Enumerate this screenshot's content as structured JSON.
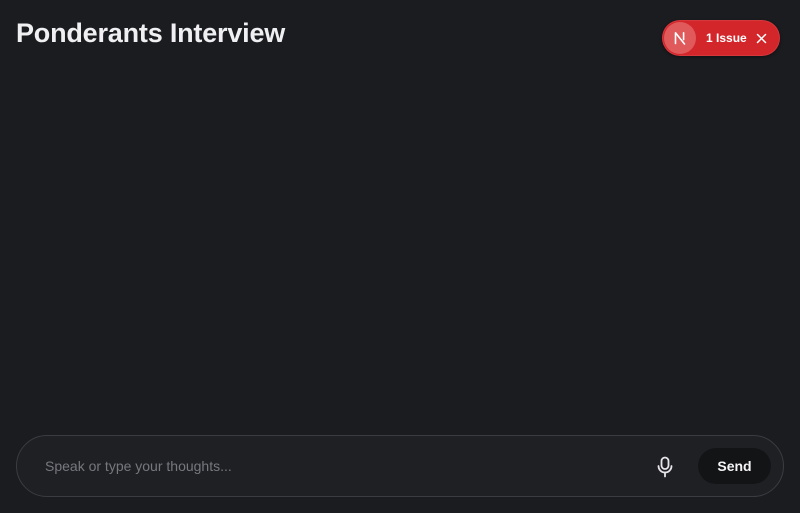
{
  "header": {
    "title": "Ponderants Interview"
  },
  "issue_badge": {
    "logo_icon": "nextjs-logo-icon",
    "label": "1 Issue",
    "close_icon": "close-icon",
    "color": "#d3262b"
  },
  "composer": {
    "input_value": "",
    "input_placeholder": "Speak or type your thoughts...",
    "mic_icon": "microphone-icon",
    "send_label": "Send"
  },
  "colors": {
    "background": "#1b1c20",
    "composer_border": "#3b3c42",
    "send_button": "#131416"
  }
}
